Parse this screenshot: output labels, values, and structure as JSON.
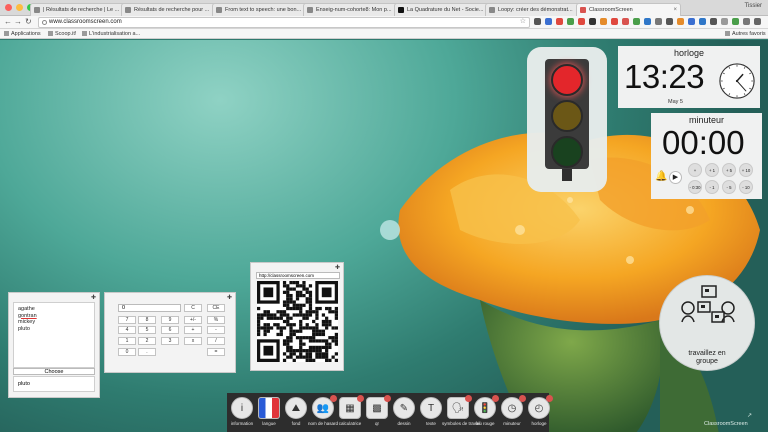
{
  "browser": {
    "tabs": [
      {
        "title": "| Résultats de recherche | Le ..."
      },
      {
        "title": "Résultats de recherche pour ..."
      },
      {
        "title": "From text to speech: une bon..."
      },
      {
        "title": "Enseig-num-cohorte8: Mon p..."
      },
      {
        "title": "La Quadrature du Net - Socie..."
      },
      {
        "title": "Loopy: créer des démonstrat..."
      },
      {
        "title": "ClassroomScreen"
      }
    ],
    "active_tab": "ClassroomScreen",
    "user_name": "Tissier",
    "url": "www.classroomscreen.com",
    "bookmarks": [
      "Applications",
      "Scoop.it!",
      "L'industrialisation a..."
    ],
    "other_bookmarks": "Autres favoris"
  },
  "random_names": {
    "names": [
      "agathe",
      "gontran",
      "mickey",
      "pluto"
    ],
    "choose_label": "Choose",
    "chosen": "pluto"
  },
  "calculator": {
    "display": "0",
    "keys": [
      "C",
      "CE",
      "7",
      "8",
      "9",
      "+/-",
      "%",
      "4",
      "5",
      "6",
      "+",
      "-",
      "1",
      "2",
      "3",
      "x",
      "/",
      "0",
      ".",
      "="
    ]
  },
  "qr": {
    "url": "http://classroomscreen.com"
  },
  "traffic_light": {
    "state": "red",
    "colors": {
      "red": "#e3262b",
      "amber": "#6b5716",
      "green": "#19421f"
    }
  },
  "clock": {
    "title": "horloge",
    "time": "13:23",
    "date": "May 5",
    "analog_hour": 13,
    "analog_minute": 23
  },
  "timer": {
    "title": "minuteur",
    "time": "00:00",
    "buttons_top": [
      "+ 0:30",
      "+ 1",
      "+ 5",
      "+ 10"
    ],
    "buttons_bottom": [
      "- 0:30",
      "- 1",
      "- 5",
      "- 10"
    ]
  },
  "work_symbol": {
    "label_line1": "travaillez en",
    "label_line2": "groupe"
  },
  "dock": {
    "items": [
      {
        "label": "information",
        "icon": "info-icon",
        "glyph": "i"
      },
      {
        "label": "langue",
        "icon": "flag-icon",
        "glyph": ""
      },
      {
        "label": "fond",
        "icon": "landscape-icon",
        "glyph": "⛰"
      },
      {
        "label": "nom de hasard",
        "icon": "random-name-icon",
        "glyph": "👥"
      },
      {
        "label": "calculatrice",
        "icon": "calculator-icon",
        "glyph": "▦"
      },
      {
        "label": "qr",
        "icon": "qr-icon",
        "glyph": "▩"
      },
      {
        "label": "dessin",
        "icon": "pencil-icon",
        "glyph": "✎"
      },
      {
        "label": "texte",
        "icon": "text-icon",
        "glyph": "T"
      },
      {
        "label": "symboles de travail",
        "icon": "work-symbols-icon",
        "glyph": "🗣"
      },
      {
        "label": "feu rouge",
        "icon": "traffic-light-icon",
        "glyph": "🚦"
      },
      {
        "label": "minuteur",
        "icon": "timer-icon",
        "glyph": "◷"
      },
      {
        "label": "horloge",
        "icon": "clock-icon",
        "glyph": "◴"
      }
    ]
  },
  "watermark": "ClassroomScreen"
}
